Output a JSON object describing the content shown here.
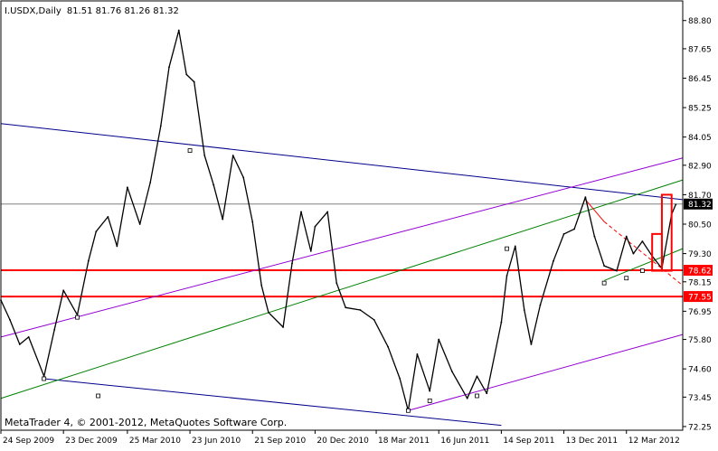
{
  "header": {
    "symbol": "I.USDX,Daily",
    "ohlc": "81.51 81.76 81.26 81.32"
  },
  "copyright": "MetaTrader 4, © 2001-2012, MetaQuotes Software Corp.",
  "colors": {
    "background": "#ffffff",
    "frame": "#000000",
    "price": "#000000",
    "blue_channel": "#00008b",
    "violet_channel": "#9400d3",
    "green_channel": "#008000",
    "support_line": "#ff0000",
    "current_price_line": "#808080",
    "down_line": "#ff0000"
  },
  "chart_data": {
    "type": "line",
    "series": [
      {
        "key": "close",
        "points": [
          [
            "2009-09-24",
            77.4
          ],
          [
            "2009-10-07",
            76.6
          ],
          [
            "2009-10-21",
            75.6
          ],
          [
            "2009-11-03",
            75.9
          ],
          [
            "2009-11-25",
            74.3
          ],
          [
            "2009-12-10",
            76.2
          ],
          [
            "2009-12-23",
            77.8
          ],
          [
            "2010-01-12",
            76.8
          ],
          [
            "2010-01-28",
            79.0
          ],
          [
            "2010-02-08",
            80.2
          ],
          [
            "2010-02-25",
            80.8
          ],
          [
            "2010-03-10",
            79.6
          ],
          [
            "2010-03-25",
            82.0
          ],
          [
            "2010-04-12",
            80.5
          ],
          [
            "2010-04-27",
            82.2
          ],
          [
            "2010-05-12",
            84.5
          ],
          [
            "2010-05-24",
            86.9
          ],
          [
            "2010-06-07",
            88.4
          ],
          [
            "2010-06-18",
            86.6
          ],
          [
            "2010-06-29",
            86.3
          ],
          [
            "2010-07-14",
            83.3
          ],
          [
            "2010-07-27",
            82.1
          ],
          [
            "2010-08-09",
            80.7
          ],
          [
            "2010-08-24",
            83.3
          ],
          [
            "2010-09-08",
            82.4
          ],
          [
            "2010-09-21",
            80.6
          ],
          [
            "2010-10-04",
            78.0
          ],
          [
            "2010-10-14",
            76.9
          ],
          [
            "2010-11-04",
            76.3
          ],
          [
            "2010-11-17",
            78.9
          ],
          [
            "2010-11-30",
            81.0
          ],
          [
            "2010-12-14",
            79.4
          ],
          [
            "2010-12-20",
            80.4
          ],
          [
            "2011-01-07",
            81.0
          ],
          [
            "2011-01-20",
            78.1
          ],
          [
            "2011-02-02",
            77.1
          ],
          [
            "2011-02-23",
            77.0
          ],
          [
            "2011-03-15",
            76.6
          ],
          [
            "2011-04-04",
            75.5
          ],
          [
            "2011-04-21",
            74.2
          ],
          [
            "2011-05-03",
            72.9
          ],
          [
            "2011-05-16",
            75.2
          ],
          [
            "2011-06-03",
            73.7
          ],
          [
            "2011-06-16",
            75.8
          ],
          [
            "2011-07-05",
            74.5
          ],
          [
            "2011-07-27",
            73.4
          ],
          [
            "2011-08-10",
            74.3
          ],
          [
            "2011-08-24",
            73.6
          ],
          [
            "2011-09-14",
            76.5
          ],
          [
            "2011-09-22",
            78.4
          ],
          [
            "2011-10-04",
            79.6
          ],
          [
            "2011-10-17",
            77.0
          ],
          [
            "2011-10-27",
            75.6
          ],
          [
            "2011-11-09",
            77.2
          ],
          [
            "2011-11-28",
            79.0
          ],
          [
            "2011-12-13",
            80.1
          ],
          [
            "2011-12-28",
            80.3
          ],
          [
            "2012-01-13",
            81.6
          ],
          [
            "2012-01-26",
            80.0
          ],
          [
            "2012-02-09",
            78.8
          ],
          [
            "2012-02-27",
            78.6
          ],
          [
            "2012-03-12",
            80.0
          ],
          [
            "2012-03-22",
            79.3
          ],
          [
            "2012-04-04",
            79.8
          ],
          [
            "2012-04-18",
            79.2
          ],
          [
            "2012-05-02",
            78.7
          ],
          [
            "2012-05-16",
            80.9
          ],
          [
            "2012-05-22",
            81.3
          ]
        ]
      }
    ],
    "y_axis": {
      "ticks": [
        "88.80",
        "87.65",
        "86.45",
        "85.25",
        "84.05",
        "82.90",
        "81.70",
        "80.50",
        "79.30",
        "78.15",
        "76.95",
        "75.80",
        "74.60",
        "73.45",
        "72.25"
      ],
      "ylim": [
        72.1,
        89.6
      ],
      "price_labels": [
        {
          "key": "current",
          "text": "81.32",
          "value": 81.32
        },
        {
          "key": "support_high",
          "text": "78.62",
          "value": 78.62
        },
        {
          "key": "support_low",
          "text": "77.55",
          "value": 77.55
        }
      ]
    },
    "x_axis": {
      "ticks": [
        {
          "text": "24 Sep 2009",
          "date": "2009-09-24"
        },
        {
          "text": "23 Dec 2009",
          "date": "2009-12-23"
        },
        {
          "text": "25 Mar 2010",
          "date": "2010-03-25"
        },
        {
          "text": "23 Jun 2010",
          "date": "2010-06-23"
        },
        {
          "text": "21 Sep 2010",
          "date": "2010-09-21"
        },
        {
          "text": "20 Dec 2010",
          "date": "2010-12-20"
        },
        {
          "text": "18 Mar 2011",
          "date": "2011-03-18"
        },
        {
          "text": "16 Jun 2011",
          "date": "2011-06-16"
        },
        {
          "text": "14 Sep 2011",
          "date": "2011-09-14"
        },
        {
          "text": "13 Dec 2011",
          "date": "2011-12-13"
        },
        {
          "text": "12 Mar 2012",
          "date": "2012-03-12"
        }
      ],
      "xlim": [
        "2009-09-24",
        "2012-06-01"
      ]
    },
    "horizontal_lines": [
      {
        "key": "current-price",
        "value": 81.32,
        "color": "#808080"
      },
      {
        "key": "support-high",
        "value": 78.62,
        "color": "#ff0000"
      },
      {
        "key": "support-low",
        "value": 77.55,
        "color": "#ff0000"
      }
    ],
    "trendlines": [
      {
        "key": "blue-upper",
        "color": "#00008b",
        "from": [
          "2009-09-24",
          84.6
        ],
        "to": [
          "2012-06-01",
          81.5
        ]
      },
      {
        "key": "blue-lower",
        "color": "#00008b",
        "from": [
          "2009-11-25",
          74.2
        ],
        "to": [
          "2011-09-14",
          72.3
        ]
      },
      {
        "key": "violet-upper",
        "color": "#9400d3",
        "from": [
          "2009-09-24",
          75.9
        ],
        "to": [
          "2012-06-01",
          83.2
        ]
      },
      {
        "key": "violet-lower",
        "color": "#9400d3",
        "from": [
          "2011-05-03",
          72.9
        ],
        "to": [
          "2012-06-01",
          76.0
        ]
      },
      {
        "key": "green-mid",
        "color": "#008000",
        "from": [
          "2009-09-24",
          73.4
        ],
        "to": [
          "2012-06-01",
          82.3
        ]
      },
      {
        "key": "green-short",
        "color": "#008000",
        "from": [
          "2012-02-09",
          78.2
        ],
        "to": [
          "2012-06-01",
          79.5
        ]
      },
      {
        "key": "red-down-solid",
        "color": "#ff0000",
        "from": [
          "2012-01-13",
          81.5
        ],
        "to": [
          "2012-02-09",
          80.6
        ]
      },
      {
        "key": "red-down-dashed",
        "color": "#ff0000",
        "from": [
          "2012-02-09",
          80.6
        ],
        "to": [
          "2012-06-01",
          78.0
        ],
        "dashed": true
      }
    ],
    "markers": [
      {
        "key": "marker-1",
        "date": "2009-11-25",
        "value": 74.2
      },
      {
        "key": "marker-2",
        "date": "2010-06-23",
        "value": 83.5
      },
      {
        "key": "marker-3",
        "date": "2010-02-11",
        "value": 73.5
      },
      {
        "key": "marker-4",
        "date": "2011-05-03",
        "value": 72.9
      },
      {
        "key": "marker-5",
        "date": "2011-06-03",
        "value": 73.3
      },
      {
        "key": "marker-6",
        "date": "2011-08-10",
        "value": 73.5
      },
      {
        "key": "marker-7",
        "date": "2011-09-22",
        "value": 79.5
      },
      {
        "key": "marker-8",
        "date": "2012-02-09",
        "value": 78.1
      },
      {
        "key": "marker-9",
        "date": "2012-03-12",
        "value": 78.3
      },
      {
        "key": "marker-10",
        "date": "2012-04-04",
        "value": 78.6
      },
      {
        "key": "marker-11",
        "date": "2010-01-12",
        "value": 76.7
      }
    ],
    "boxes": [
      {
        "key": "red-box-tall",
        "from": [
          "2012-05-02",
          78.6
        ],
        "to": [
          "2012-05-16",
          81.7
        ]
      },
      {
        "key": "red-box-small",
        "from": [
          "2012-04-18",
          78.6
        ],
        "to": [
          "2012-05-02",
          80.1
        ]
      }
    ]
  }
}
